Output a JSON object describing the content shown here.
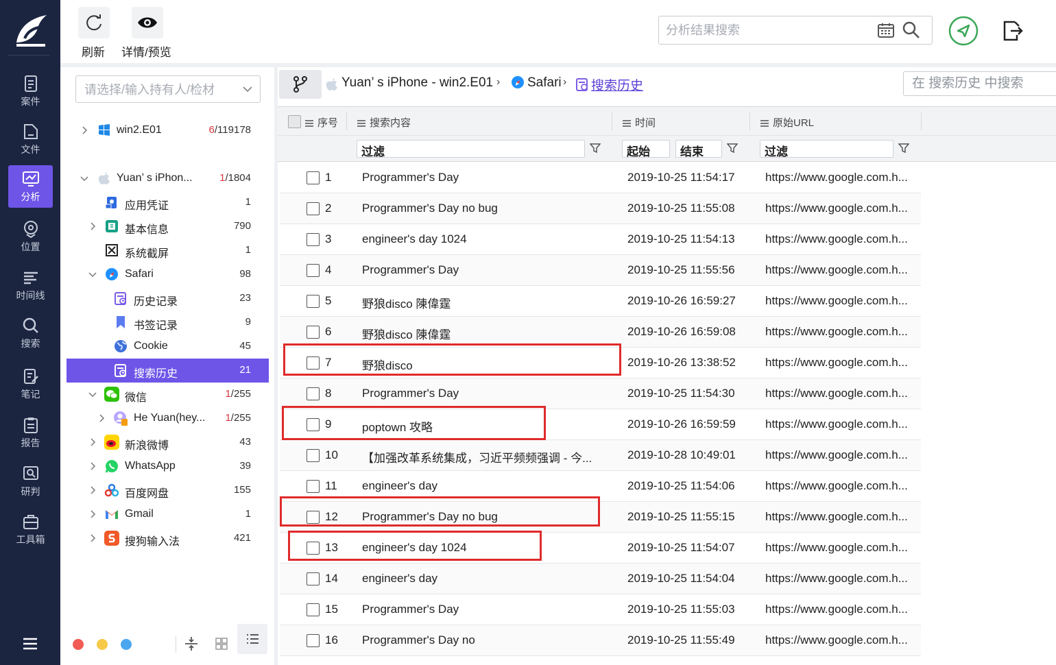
{
  "nav": {
    "items": [
      {
        "label": "案件",
        "icon": "case-icon"
      },
      {
        "label": "文件",
        "icon": "file-icon"
      },
      {
        "label": "分析",
        "icon": "analysis-icon",
        "active": true
      },
      {
        "label": "位置",
        "icon": "location-icon"
      },
      {
        "label": "时间线",
        "icon": "timeline-icon"
      },
      {
        "label": "搜索",
        "icon": "search-icon"
      },
      {
        "label": "笔记",
        "icon": "notes-icon"
      },
      {
        "label": "报告",
        "icon": "report-icon"
      },
      {
        "label": "研判",
        "icon": "judge-icon"
      },
      {
        "label": "工具箱",
        "icon": "toolbox-icon"
      }
    ]
  },
  "toolbar": {
    "refresh_label": "刷新",
    "details_label": "详情/预览",
    "search_placeholder": "分析结果搜索"
  },
  "tree": {
    "owner_placeholder": "请选择/输入持有人/检材",
    "rows": [
      {
        "label": "win2.E01",
        "count_red": "6",
        "count_rest": "/119178"
      },
      {
        "label": "Yuan’ s iPhon...",
        "count_red": "1",
        "count_rest": "/1804"
      },
      {
        "label": "应用凭证",
        "count": "1"
      },
      {
        "label": "基本信息",
        "count": "790"
      },
      {
        "label": "系统截屏",
        "count": "1"
      },
      {
        "label": "Safari",
        "count": "98"
      },
      {
        "label": "历史记录",
        "count": "23"
      },
      {
        "label": "书签记录",
        "count": "9"
      },
      {
        "label": "Cookie",
        "count": "45"
      },
      {
        "label": "搜索历史",
        "count": "21"
      },
      {
        "label": "微信",
        "count_red": "1",
        "count_rest": "/255"
      },
      {
        "label": "He Yuan(hey...",
        "count_red": "1",
        "count_rest": "/255"
      },
      {
        "label": "新浪微博",
        "count": "43"
      },
      {
        "label": "WhatsApp",
        "count": "39"
      },
      {
        "label": "百度网盘",
        "count": "155"
      },
      {
        "label": "Gmail",
        "count": "1"
      },
      {
        "label": "搜狗输入法",
        "count": "421"
      }
    ]
  },
  "breadcrumb": {
    "device": "Yuan’ s iPhone - win2.E01",
    "app": "Safari",
    "current": "搜索历史",
    "search_placeholder": "在 搜索历史 中搜索"
  },
  "grid": {
    "headers": {
      "index": "序号",
      "content": "搜索内容",
      "time": "时间",
      "url": "原始URL"
    },
    "filters": {
      "content": "过滤",
      "start": "起始",
      "end": "结束",
      "url": "过滤"
    },
    "rows": [
      {
        "n": "1",
        "content": "Programmer's Day",
        "time": "2019-10-25 11:54:17",
        "url": "https://www.google.com.h..."
      },
      {
        "n": "2",
        "content": "Programmer's Day no bug",
        "time": "2019-10-25 11:55:08",
        "url": "https://www.google.com.h..."
      },
      {
        "n": "3",
        "content": "engineer's day 1024",
        "time": "2019-10-25 11:54:13",
        "url": "https://www.google.com.h..."
      },
      {
        "n": "4",
        "content": "Programmer's Day",
        "time": "2019-10-25 11:55:56",
        "url": "https://www.google.com.h..."
      },
      {
        "n": "5",
        "content": "野狼disco 陳偉霆",
        "time": "2019-10-26 16:59:27",
        "url": "https://www.google.com.h..."
      },
      {
        "n": "6",
        "content": "野狼disco 陳偉霆",
        "time": "2019-10-26 16:59:08",
        "url": "https://www.google.com.h..."
      },
      {
        "n": "7",
        "content": "野狼disco",
        "time": "2019-10-26 13:38:52",
        "url": "https://www.google.com.h..."
      },
      {
        "n": "8",
        "content": "Programmer's Day",
        "time": "2019-10-25 11:54:30",
        "url": "https://www.google.com.h..."
      },
      {
        "n": "9",
        "content": "poptown 攻略",
        "time": "2019-10-26 16:59:59",
        "url": "https://www.google.com.h..."
      },
      {
        "n": "10",
        "content": "【加强改革系统集成，习近平频频强调 - 今...",
        "time": "2019-10-28 10:49:01",
        "url": "https://www.google.com.h..."
      },
      {
        "n": "11",
        "content": "engineer's day",
        "time": "2019-10-25 11:54:06",
        "url": "https://www.google.com.h..."
      },
      {
        "n": "12",
        "content": "Programmer's Day no bug",
        "time": "2019-10-25 11:55:15",
        "url": "https://www.google.com.h..."
      },
      {
        "n": "13",
        "content": "engineer's day 1024",
        "time": "2019-10-25 11:54:07",
        "url": "https://www.google.com.h..."
      },
      {
        "n": "14",
        "content": "engineer's day",
        "time": "2019-10-25 11:54:04",
        "url": "https://www.google.com.h..."
      },
      {
        "n": "15",
        "content": "Programmer's Day",
        "time": "2019-10-25 11:55:03",
        "url": "https://www.google.com.h..."
      },
      {
        "n": "16",
        "content": "Programmer's Day no",
        "time": "2019-10-25 11:55:49",
        "url": "https://www.google.com.h..."
      }
    ]
  },
  "colors": {
    "accent": "#6e55e8",
    "nav_bg": "#1b2540",
    "highlight": "#e02a2a"
  }
}
